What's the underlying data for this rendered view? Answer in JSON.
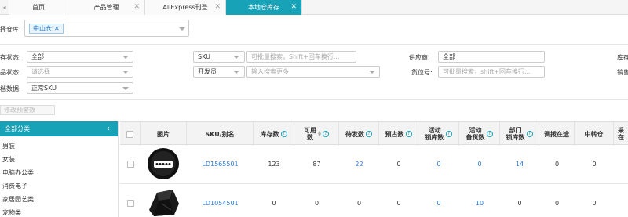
{
  "tabs": [
    {
      "label": "首页",
      "active": false
    },
    {
      "label": "产品管理",
      "active": false
    },
    {
      "label": "AliExpress刊登",
      "active": false
    },
    {
      "label": "本地仓库存",
      "active": true
    }
  ],
  "filters": {
    "warehouse_label": "择仓库:",
    "warehouse_chip": "中山仓",
    "stock_status_label": "存状态:",
    "stock_status_value": "全部",
    "product_status_label": "品状态:",
    "product_status_placeholder": "请选择",
    "archive_label": "档数据:",
    "archive_value": "正常SKU",
    "search_type_value": "SKU",
    "search_placeholder": "可批量搜索，Shift+回车换行...",
    "person_type_value": "开发员",
    "person_placeholder": "输入搜索更多",
    "supplier_label": "供应商:",
    "supplier_value": "全部",
    "location_label": "货位号:",
    "location_placeholder": "可批量搜索，shift+回车换行...",
    "right_label_1": "库存",
    "right_label_2": "销售"
  },
  "toolbar": {
    "batch_button": "修改预警数"
  },
  "sidebar": {
    "header": "全部分类",
    "items": [
      "男装",
      "女装",
      "电脑办公类",
      "消费电子",
      "家居园艺类",
      "宠物类"
    ]
  },
  "table": {
    "headers": {
      "image": "图片",
      "sku": "SKU/别名",
      "stock": "库存数",
      "available_1": "可用",
      "available_2": "数",
      "pending": "待发数",
      "reserved": "预占数",
      "activity_lock_1": "活动",
      "activity_lock_2": "锁库数",
      "activity_stock_1": "活动",
      "activity_stock_2": "备货数",
      "dept_lock_1": "部门",
      "dept_lock_2": "锁库数",
      "transfer": "调拨在途",
      "transit": "中转仓",
      "purchase_1": "采",
      "purchase_2": "在"
    },
    "rows": [
      {
        "sku": "LD1565501",
        "stock": "123",
        "available": "87",
        "pending": "22",
        "reserved": "0",
        "activity_lock": "0",
        "activity_stock": "0",
        "dept_lock": "14",
        "transfer": "0",
        "transit": "0"
      },
      {
        "sku": "LD1054501",
        "stock": "0",
        "available": "0",
        "pending": "0",
        "reserved": "0",
        "activity_lock": "0",
        "activity_stock": "10",
        "dept_lock": "0",
        "transfer": "0",
        "transit": "0"
      }
    ]
  },
  "colors": {
    "accent": "#17a2b8",
    "link": "#2b7bd6"
  }
}
